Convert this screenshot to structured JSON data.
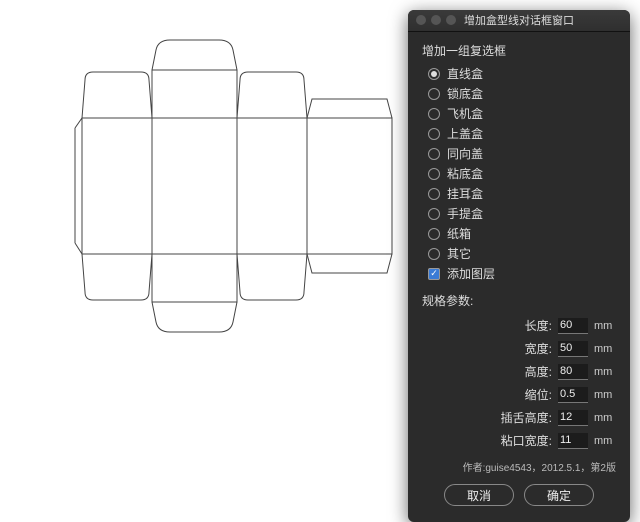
{
  "dialog": {
    "title": "增加盒型线对话框窗口",
    "group_label": "增加一组复选框",
    "options": [
      {
        "label": "直线盒",
        "type": "radio",
        "checked": true
      },
      {
        "label": "锁底盒",
        "type": "radio",
        "checked": false
      },
      {
        "label": "飞机盒",
        "type": "radio",
        "checked": false
      },
      {
        "label": "上盖盒",
        "type": "radio",
        "checked": false
      },
      {
        "label": "同向盖",
        "type": "radio",
        "checked": false
      },
      {
        "label": "粘底盒",
        "type": "radio",
        "checked": false
      },
      {
        "label": "挂耳盒",
        "type": "radio",
        "checked": false
      },
      {
        "label": "手提盒",
        "type": "radio",
        "checked": false
      },
      {
        "label": "纸箱",
        "type": "radio",
        "checked": false
      },
      {
        "label": "其它",
        "type": "radio",
        "checked": false
      },
      {
        "label": "添加图层",
        "type": "checkbox",
        "checked": true
      }
    ],
    "spec_label": "规格参数:",
    "params": [
      {
        "label": "长度:",
        "value": "60",
        "unit": "mm"
      },
      {
        "label": "宽度:",
        "value": "50",
        "unit": "mm"
      },
      {
        "label": "高度:",
        "value": "80",
        "unit": "mm"
      },
      {
        "label": "缩位:",
        "value": "0.5",
        "unit": "mm"
      },
      {
        "label": "插舌高度:",
        "value": "12",
        "unit": "mm"
      },
      {
        "label": "粘口宽度:",
        "value": "11",
        "unit": "mm"
      }
    ],
    "credit": "作者:guise4543，2012.5.1，第2版",
    "buttons": {
      "cancel": "取消",
      "ok": "确定"
    }
  }
}
